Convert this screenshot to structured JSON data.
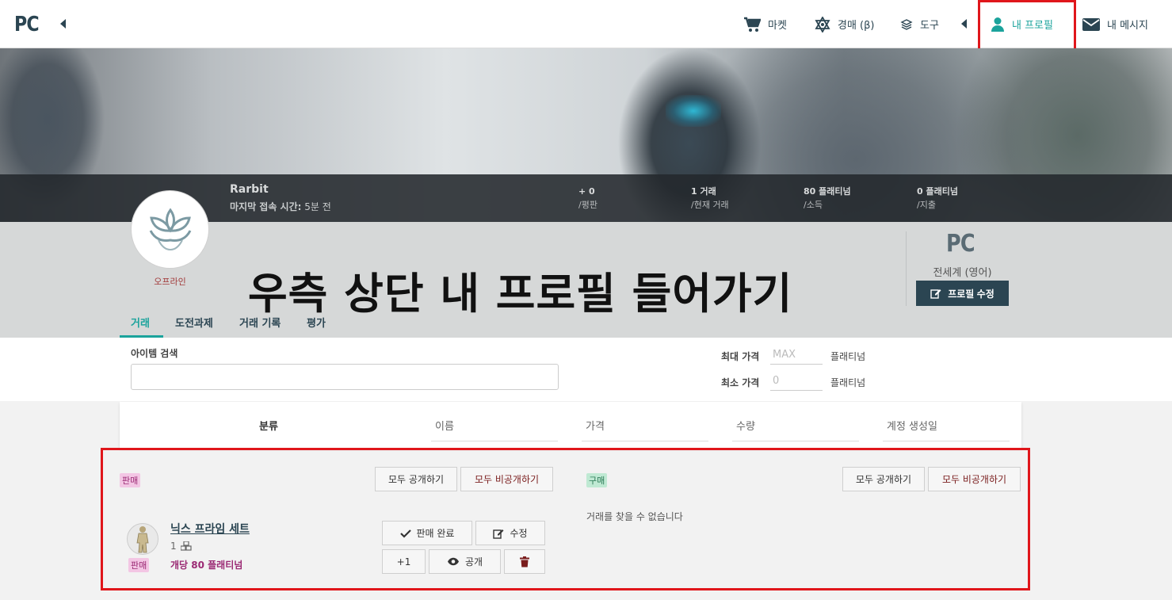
{
  "nav": {
    "logo": "PC",
    "market": "마켓",
    "auction": "경매 (β)",
    "tools": "도구",
    "my_profile": "내 프로필",
    "my_messages": "내 메시지"
  },
  "profile": {
    "username": "Rarbit",
    "last_seen_label": "마지막 접속 시간:",
    "last_seen_value": "5분 전",
    "status": "오프라인",
    "stats": [
      {
        "value": "+ 0",
        "label": "/평판"
      },
      {
        "value": "1 거래",
        "label": "/현재 거래"
      },
      {
        "value": "80 플래티넘",
        "label": "/소득"
      },
      {
        "value": "0 플래티넘",
        "label": "/지출"
      }
    ],
    "platform": "PC",
    "region": "전세계 (영어)",
    "edit_button": "프로필 수정"
  },
  "overlay_caption": "우측 상단 내 프로필 들어가기",
  "tabs": [
    "거래",
    "도전과제",
    "거래 기록",
    "평가"
  ],
  "filter": {
    "search_label": "아이템 검색",
    "search_value": "",
    "max_price_label": "최대 가격",
    "max_price_placeholder": "MAX",
    "min_price_label": "최소 가격",
    "min_price_placeholder": "0",
    "unit": "플래티넘"
  },
  "table_headers": [
    "분류",
    "이름",
    "가격",
    "수량",
    "계정 생성일"
  ],
  "sell": {
    "tag": "판매",
    "show_all": "모두 공개하기",
    "hide_all": "모두 비공개하기",
    "order": {
      "name": "닉스 프라임 세트",
      "quantity": "1",
      "tag": "판매",
      "price": "개당 80 플래티넘",
      "btn_complete": "판매 완료",
      "btn_edit": "수정",
      "btn_plus": "+1",
      "btn_visible": "공개"
    }
  },
  "buy": {
    "tag": "구매",
    "show_all": "모두 공개하기",
    "hide_all": "모두 비공개하기",
    "empty": "거래를 찾을 수 없습니다"
  },
  "colors": {
    "accent": "#1ba39c",
    "dark": "#2b4552",
    "highlight": "#e0161b"
  }
}
